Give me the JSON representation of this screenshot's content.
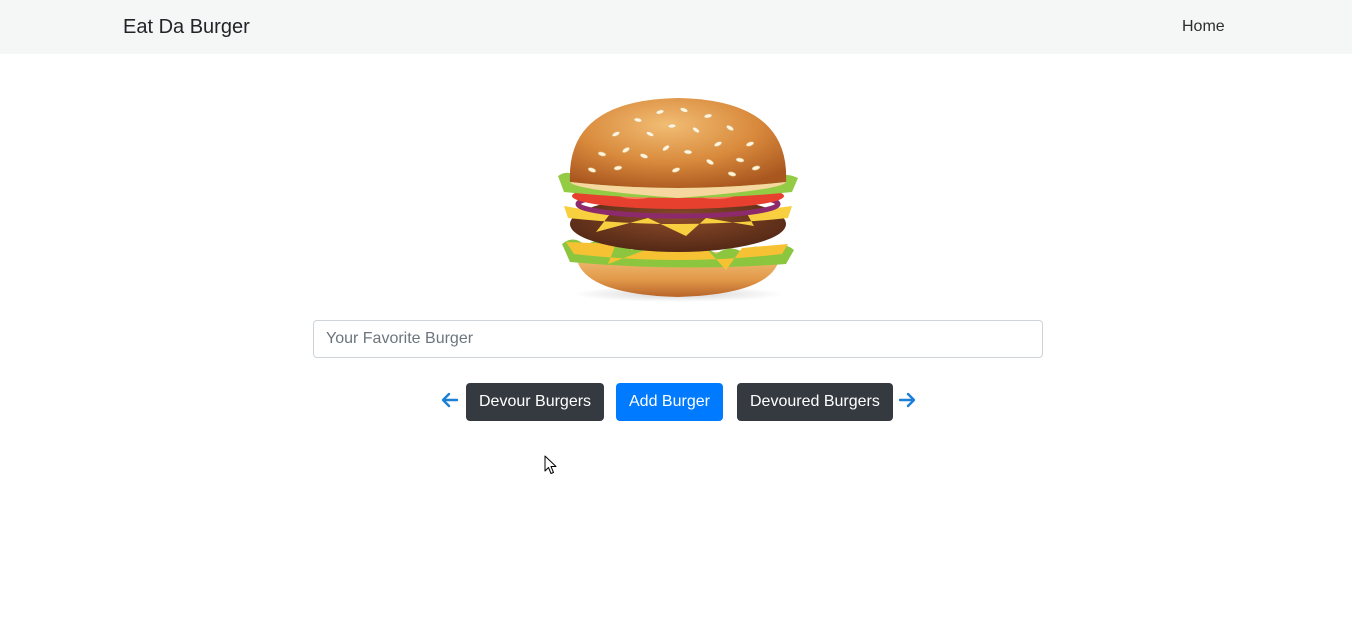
{
  "navbar": {
    "brand": "Eat Da Burger",
    "home_link": "Home"
  },
  "hero": {
    "image": "burger-illustration"
  },
  "form": {
    "burger_input_placeholder": "Your Favorite Burger",
    "burger_input_value": ""
  },
  "actions": {
    "prev_icon": "arrow-left-icon",
    "devour_label": "Devour Burgers",
    "add_label": "Add Burger",
    "devoured_label": "Devoured Burgers",
    "next_icon": "arrow-right-icon"
  },
  "colors": {
    "navbar_bg": "#f5f6f6",
    "primary": "#007bff",
    "dark": "#343a40",
    "arrow": "#1b7fd6"
  }
}
